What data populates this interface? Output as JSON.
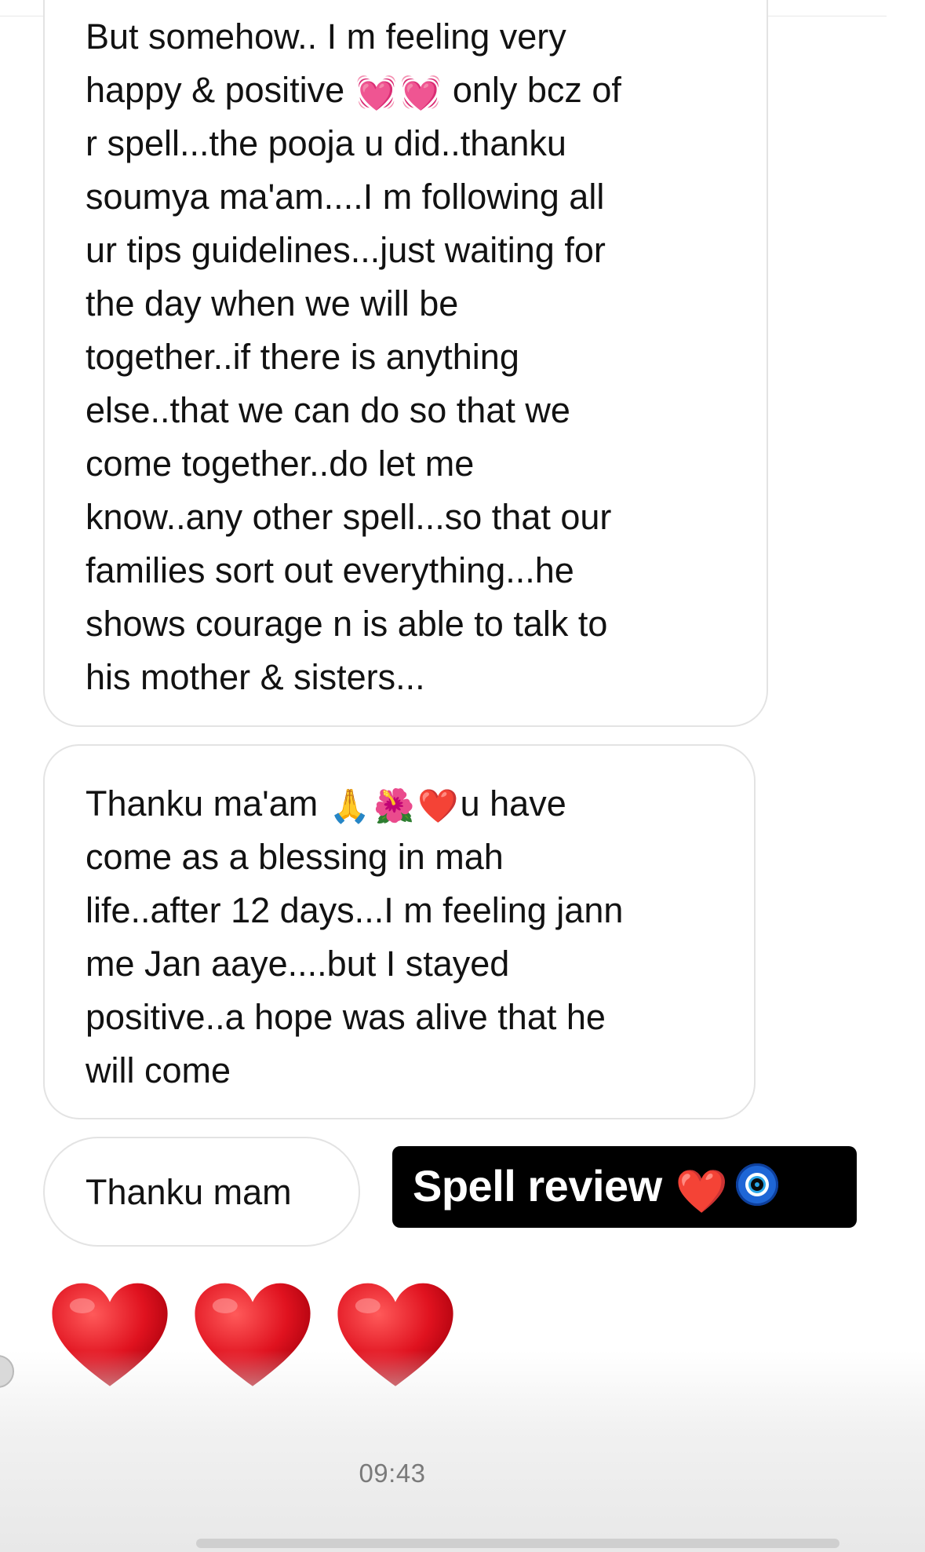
{
  "messages": [
    {
      "lines_before_emoji": "But somehow.. I m feeling very\nhappy & positive ",
      "emoji_1": "💓",
      "emoji_2": "💓",
      "lines_after_emoji": " only bcz of\nr spell...the pooja u did..thanku\nsoumya ma'am....I m following all\nur tips guidelines...just waiting for\nthe day when we will be\ntogether..if there is anything\nelse..that we can do so that we\ncome together..do let me\nknow..any other spell...so that our\nfamilies sort out everything...he\nshows courage n is able to talk to\nhis mother & sisters..."
    },
    {
      "lead": "Thanku ma'am ",
      "emoji_1": "🙏",
      "emoji_2": "🌺",
      "emoji_3": "❤️",
      "rest": "u have\ncome as a blessing in mah\nlife..after 12 days...I m feeling jann\nme Jan aaye....but I stayed\npositive..a hope was alive that he\nwill come"
    },
    {
      "text": "Thanku mam"
    }
  ],
  "sticker": {
    "text": "Spell review ",
    "heart_emoji": "❤️",
    "icon": "evil-eye-icon"
  },
  "reaction": {
    "hearts": [
      "heart-icon",
      "heart-icon",
      "heart-icon"
    ]
  },
  "timestamp": "09:43",
  "colors": {
    "bubble_border": "#e3e3e3",
    "sticker_bg": "#000000",
    "heart_red": "#e0121f",
    "timestamp_gray": "#7a7a7a"
  }
}
